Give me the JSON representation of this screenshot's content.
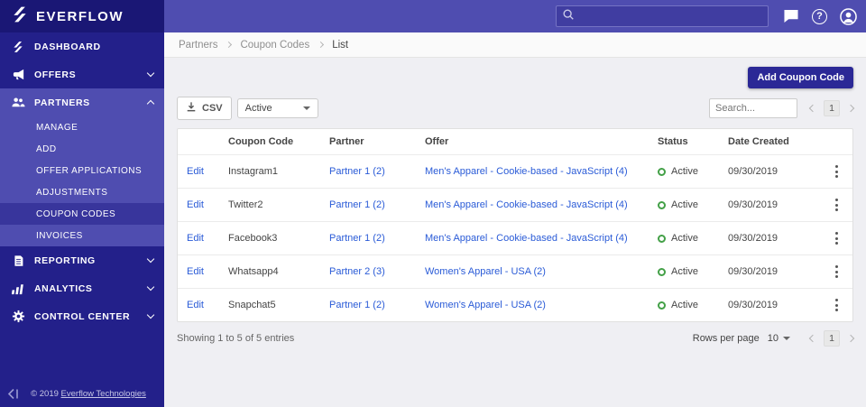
{
  "brand": {
    "name": "EVERFLOW"
  },
  "header": {
    "help_glyph": "?"
  },
  "sidebar": {
    "items": [
      {
        "label": "DASHBOARD"
      },
      {
        "label": "OFFERS"
      },
      {
        "label": "PARTNERS"
      },
      {
        "label": "REPORTING"
      },
      {
        "label": "ANALYTICS"
      },
      {
        "label": "CONTROL CENTER"
      }
    ],
    "partners_submenu": [
      {
        "label": "MANAGE"
      },
      {
        "label": "ADD"
      },
      {
        "label": "OFFER APPLICATIONS"
      },
      {
        "label": "ADJUSTMENTS"
      },
      {
        "label": "COUPON CODES"
      },
      {
        "label": "INVOICES"
      }
    ],
    "footer": {
      "copyright_prefix": "© 2019 ",
      "copyright_link": "Everflow Technologies"
    }
  },
  "breadcrumb": {
    "items": [
      "Partners",
      "Coupon Codes",
      "List"
    ]
  },
  "page": {
    "add_button": "Add Coupon Code",
    "csv_button": "CSV",
    "status_filter": "Active",
    "search_placeholder": "Search...",
    "top_page": "1"
  },
  "table": {
    "headers": {
      "coupon_code": "Coupon Code",
      "partner": "Partner",
      "offer": "Offer",
      "status": "Status",
      "date_created": "Date Created"
    },
    "edit_label": "Edit",
    "rows": [
      {
        "coupon_code": "Instagram1",
        "partner": "Partner 1 (2)",
        "offer": "Men's Apparel - Cookie-based - JavaScript (4)",
        "status": "Active",
        "date_created": "09/30/2019"
      },
      {
        "coupon_code": "Twitter2",
        "partner": "Partner 1 (2)",
        "offer": "Men's Apparel - Cookie-based - JavaScript (4)",
        "status": "Active",
        "date_created": "09/30/2019"
      },
      {
        "coupon_code": "Facebook3",
        "partner": "Partner 1 (2)",
        "offer": "Men's Apparel - Cookie-based - JavaScript (4)",
        "status": "Active",
        "date_created": "09/30/2019"
      },
      {
        "coupon_code": "Whatsapp4",
        "partner": "Partner 2 (3)",
        "offer": "Women's Apparel - USA (2)",
        "status": "Active",
        "date_created": "09/30/2019"
      },
      {
        "coupon_code": "Snapchat5",
        "partner": "Partner 1 (2)",
        "offer": "Women's Apparel - USA (2)",
        "status": "Active",
        "date_created": "09/30/2019"
      }
    ]
  },
  "footer": {
    "showing": "Showing 1 to 5 of 5 entries",
    "rows_per_page_label": "Rows per page",
    "rows_per_page_value": "10",
    "page": "1"
  },
  "colors": {
    "accent": "#2b2896",
    "link": "#2a5bd7",
    "status_green": "#43a047",
    "sidebar": "#23208a"
  }
}
